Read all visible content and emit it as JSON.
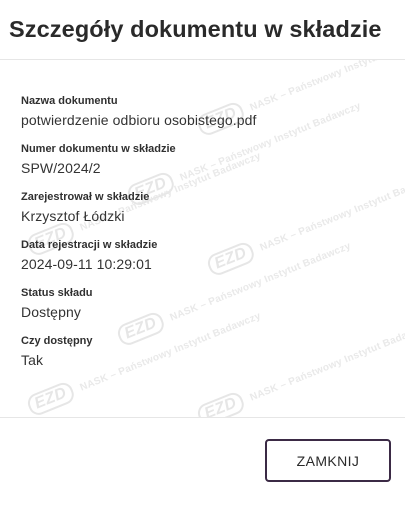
{
  "dialog": {
    "title": "Szczegóły dokumentu w składzie",
    "fields": [
      {
        "label": "Nazwa dokumentu",
        "value": "potwierdzenie odbioru osobistego.pdf"
      },
      {
        "label": "Numer dokumentu w składzie",
        "value": "SPW/2024/2"
      },
      {
        "label": "Zarejestrował w składzie",
        "value": "Krzysztof Łódzki"
      },
      {
        "label": "Data rejestracji w składzie",
        "value": "2024-09-11 10:29:01"
      },
      {
        "label": "Status składu",
        "value": "Dostępny"
      },
      {
        "label": "Czy dostępny",
        "value": "Tak"
      }
    ],
    "close_label": "ZAMKNIJ"
  },
  "watermark": {
    "logo": "EZD",
    "text": "NASK – Państwowy Instytut Badawczy"
  },
  "colors": {
    "button_border": "#3b2a45",
    "watermark": "#e8e8e8",
    "divider": "#e6e6e6"
  }
}
